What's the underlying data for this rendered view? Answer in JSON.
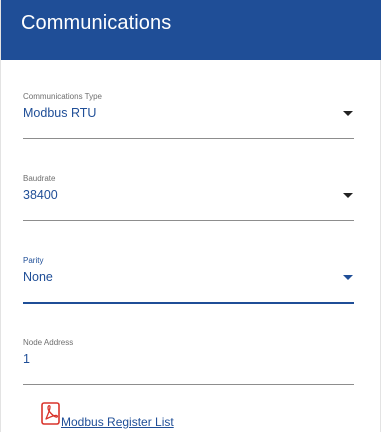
{
  "header": {
    "title": "Communications"
  },
  "fields": [
    {
      "label": "Communications Type",
      "value": "Modbus RTU",
      "icon": "chevron-down-icon"
    },
    {
      "label": "Baudrate",
      "value": "38400",
      "icon": "chevron-down-icon"
    },
    {
      "label": "Parity",
      "value": "None",
      "icon": "chevron-down-icon",
      "state": "focused"
    },
    {
      "label": "Node Address",
      "value": "1"
    }
  ],
  "link": {
    "text": "Modbus Register List",
    "icon": "pdf-icon"
  },
  "colors": {
    "accent": "#1f4e97",
    "header_bg": "#1f4e97",
    "pdf_red": "#d9342b"
  }
}
